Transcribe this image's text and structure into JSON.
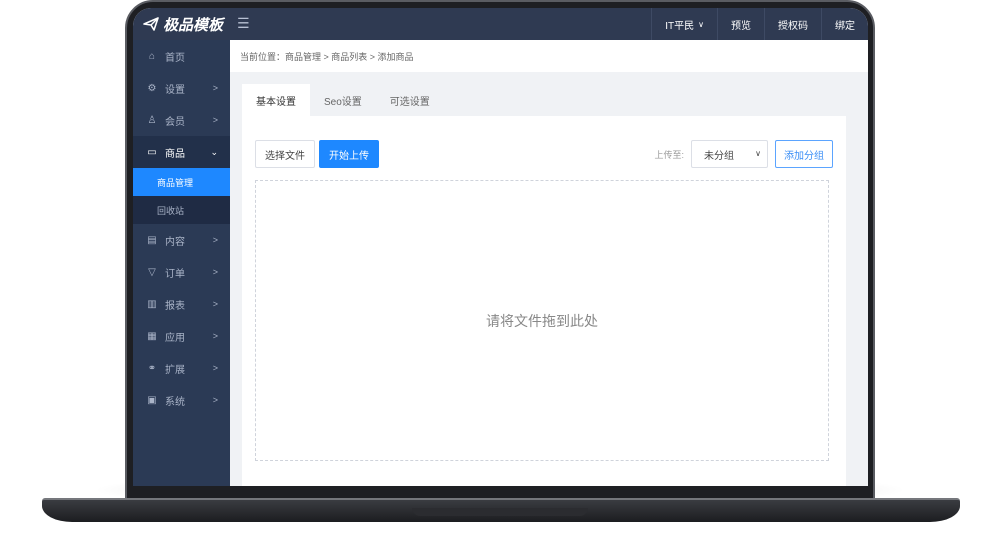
{
  "header": {
    "logo_text": "极品模板",
    "menu_toggle": "☰",
    "user_label": "IT平民",
    "nav": [
      "预览",
      "授权码",
      "绑定"
    ]
  },
  "sidebar": {
    "items": [
      {
        "label": "首页",
        "icon": "⌂",
        "icon_name": "home-icon"
      },
      {
        "label": "设置",
        "icon": "⚙",
        "icon_name": "gear-icon",
        "arrow": ">"
      },
      {
        "label": "会员",
        "icon": "♙",
        "icon_name": "user-icon",
        "arrow": ">"
      },
      {
        "label": "商品",
        "icon": "▭",
        "icon_name": "bag-icon",
        "arrow": "⌄"
      },
      {
        "label": "内容",
        "icon": "▤",
        "icon_name": "content-icon",
        "arrow": ">"
      },
      {
        "label": "订单",
        "icon": "▽",
        "icon_name": "order-icon",
        "arrow": ">"
      },
      {
        "label": "报表",
        "icon": "▥",
        "icon_name": "chart-icon",
        "arrow": ">"
      },
      {
        "label": "应用",
        "icon": "▦",
        "icon_name": "apps-icon",
        "arrow": ">"
      },
      {
        "label": "扩展",
        "icon": "⚭",
        "icon_name": "link-icon",
        "arrow": ">"
      },
      {
        "label": "系统",
        "icon": "▣",
        "icon_name": "system-icon",
        "arrow": ">"
      }
    ],
    "sub_items": [
      "商品管理",
      "回收站"
    ]
  },
  "breadcrumb": "当前位置：商品管理 > 商品列表 > 添加商品",
  "tabs": [
    "基本设置",
    "Seo设置",
    "可选设置"
  ],
  "toolbar": {
    "choose_file": "选择文件",
    "start_upload": "开始上传",
    "upload_to": "上传至:",
    "group_select": "未分组",
    "add_group": "添加分组"
  },
  "dropzone_text": "请将文件拖到此处",
  "colors": {
    "accent": "#1e88ff",
    "topbar": "#2f3a52",
    "sidebar": "#2b3a55"
  }
}
